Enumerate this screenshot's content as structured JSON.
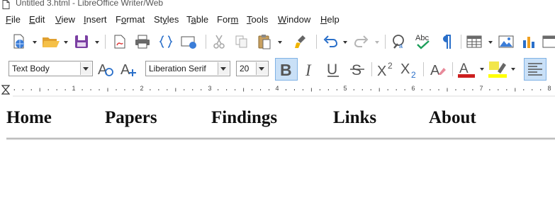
{
  "window": {
    "title": "Untitled 3.html - LibreOffice Writer/Web"
  },
  "menubar": {
    "items": [
      "File",
      "Edit",
      "View",
      "Insert",
      "Format",
      "Styles",
      "Table",
      "Form",
      "Tools",
      "Window",
      "Help"
    ],
    "mnemonics": [
      "F",
      "E",
      "V",
      "I",
      "o",
      "y",
      "a",
      "m",
      "T",
      "W",
      "H"
    ]
  },
  "formatting": {
    "paragraph_style": "Text Body",
    "font_name": "Liberation Serif",
    "font_size": "20",
    "bold_active": true,
    "font_color": "#cc1f1f",
    "highlight_color": "#ffff00"
  },
  "ruler": {
    "labels": [
      "1",
      "2",
      "3",
      "4",
      "5",
      "6",
      "7",
      "8"
    ]
  },
  "document": {
    "nav_links": [
      "Home",
      "Papers",
      "Findings",
      "Links",
      "About"
    ]
  },
  "toolbar1": {
    "icons": [
      "document-properties-icon",
      "open-folder-icon",
      "save-icon",
      "export-pdf-icon",
      "print-icon",
      "html-source-icon",
      "preview-web-icon",
      "cut-icon",
      "copy-icon",
      "paste-icon",
      "clone-formatting-icon",
      "undo-icon",
      "redo-icon",
      "find-replace-icon",
      "spelling-icon",
      "formatting-marks-icon",
      "insert-table-icon",
      "insert-image-icon",
      "insert-chart-icon"
    ]
  },
  "toolbar2": {
    "icons": [
      "update-style-icon",
      "new-style-icon",
      "bold-icon",
      "italic-icon",
      "underline-icon",
      "strikethrough-icon",
      "superscript-icon",
      "subscript-icon",
      "clear-formatting-icon",
      "font-color-icon",
      "highlight-color-icon",
      "align-left-icon"
    ]
  }
}
